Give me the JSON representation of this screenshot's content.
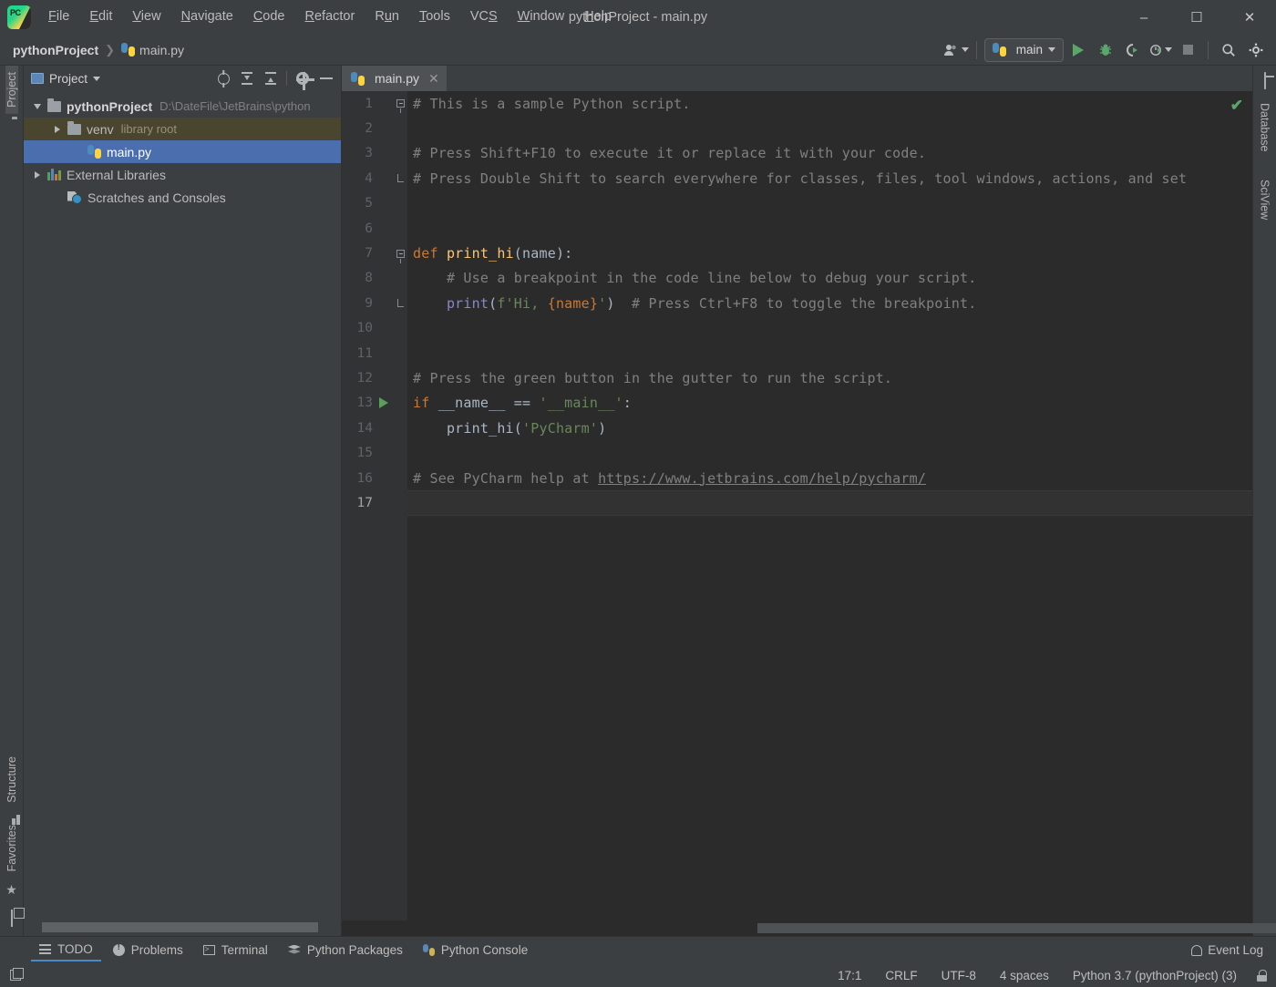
{
  "window": {
    "title": "pythonProject - main.py",
    "minimize_label": "–",
    "maximize_label": "☐",
    "close_label": "✕"
  },
  "menubar": {
    "items": [
      {
        "label": "File",
        "mnemonic": "F"
      },
      {
        "label": "Edit",
        "mnemonic": "E"
      },
      {
        "label": "View",
        "mnemonic": "V"
      },
      {
        "label": "Navigate",
        "mnemonic": "N"
      },
      {
        "label": "Code",
        "mnemonic": "C"
      },
      {
        "label": "Refactor",
        "mnemonic": "R"
      },
      {
        "label": "Run",
        "mnemonic": "u"
      },
      {
        "label": "Tools",
        "mnemonic": "T"
      },
      {
        "label": "VCS",
        "mnemonic": "S"
      },
      {
        "label": "Window",
        "mnemonic": "W"
      },
      {
        "label": "Help",
        "mnemonic": "H"
      }
    ]
  },
  "navbar": {
    "breadcrumb": [
      {
        "label": "pythonProject",
        "icon": "none"
      },
      {
        "label": "main.py",
        "icon": "python-file-icon"
      }
    ],
    "run_config": {
      "label": "main",
      "icon": "python-icon"
    },
    "buttons": [
      {
        "name": "user-account-button",
        "label": ""
      },
      {
        "name": "run-button",
        "label": ""
      },
      {
        "name": "debug-button",
        "label": ""
      },
      {
        "name": "run-coverage-button",
        "label": ""
      },
      {
        "name": "profile-button",
        "label": ""
      },
      {
        "name": "stop-button",
        "label": ""
      },
      {
        "name": "search-everywhere-button",
        "label": ""
      },
      {
        "name": "settings-button",
        "label": ""
      }
    ]
  },
  "left_stripe": {
    "top": [
      {
        "label": "Project",
        "selected": true
      }
    ],
    "bottom": [
      {
        "label": "Structure"
      },
      {
        "label": "Favorites"
      }
    ]
  },
  "right_stripe": {
    "items": [
      {
        "label": "Database"
      },
      {
        "label": "SciView"
      }
    ]
  },
  "project_panel": {
    "title": "Project",
    "tools": [
      "locate-icon",
      "expand-all-icon",
      "collapse-all-icon",
      "settings-icon",
      "hide-icon"
    ],
    "tree": [
      {
        "label": "pythonProject",
        "sub": "D:\\DateFile\\JetBrains\\python",
        "icon": "folder-icon",
        "arrow": "down",
        "indent": 0,
        "bold": true,
        "state": "normal"
      },
      {
        "label": "venv",
        "sub": "library root",
        "icon": "folder-icon",
        "arrow": "right",
        "indent": 1,
        "bold": false,
        "state": "excluded"
      },
      {
        "label": "main.py",
        "sub": "",
        "icon": "python-file-icon",
        "arrow": "none",
        "indent": 2,
        "bold": false,
        "state": "selected"
      },
      {
        "label": "External Libraries",
        "sub": "",
        "icon": "library-icon",
        "arrow": "right",
        "indent": 0,
        "bold": false,
        "state": "normal"
      },
      {
        "label": "Scratches and Consoles",
        "sub": "",
        "icon": "scratch-icon",
        "arrow": "none",
        "indent": 1,
        "bold": false,
        "state": "normal"
      }
    ]
  },
  "editor": {
    "tabs": [
      {
        "label": "main.py",
        "icon": "python-file-icon",
        "active": true,
        "close": "✕"
      }
    ],
    "inspection_status": "✔",
    "current_line": 17,
    "lines": [
      {
        "n": 1,
        "fold": "start",
        "runmark": false,
        "tokens": [
          {
            "t": "# This is a sample Python script.",
            "c": "cmt"
          }
        ]
      },
      {
        "n": 2,
        "fold": "none",
        "runmark": false,
        "tokens": []
      },
      {
        "n": 3,
        "fold": "none",
        "runmark": false,
        "tokens": [
          {
            "t": "# Press Shift+F10 to execute it or replace it with your code.",
            "c": "cmt"
          }
        ]
      },
      {
        "n": 4,
        "fold": "end",
        "runmark": false,
        "tokens": [
          {
            "t": "# Press Double Shift to search everywhere for classes, files, tool windows, actions, and set",
            "c": "cmt"
          }
        ]
      },
      {
        "n": 5,
        "fold": "none",
        "runmark": false,
        "tokens": []
      },
      {
        "n": 6,
        "fold": "none",
        "runmark": false,
        "tokens": []
      },
      {
        "n": 7,
        "fold": "start",
        "runmark": false,
        "tokens": [
          {
            "t": "def ",
            "c": "kw"
          },
          {
            "t": "print_hi",
            "c": "fn"
          },
          {
            "t": "(name):",
            "c": "pun"
          }
        ]
      },
      {
        "n": 8,
        "fold": "none",
        "runmark": false,
        "tokens": [
          {
            "t": "    ",
            "c": "pun"
          },
          {
            "t": "# Use a breakpoint in the code line below to debug your script.",
            "c": "cmt"
          }
        ]
      },
      {
        "n": 9,
        "fold": "end",
        "runmark": false,
        "tokens": [
          {
            "t": "    ",
            "c": "pun"
          },
          {
            "t": "print",
            "c": "bi"
          },
          {
            "t": "(",
            "c": "pun"
          },
          {
            "t": "f'Hi, ",
            "c": "str"
          },
          {
            "t": "{name}",
            "c": "kw"
          },
          {
            "t": "'",
            "c": "str"
          },
          {
            "t": ")  ",
            "c": "pun"
          },
          {
            "t": "# Press Ctrl+F8 to toggle the breakpoint.",
            "c": "cmt"
          }
        ]
      },
      {
        "n": 10,
        "fold": "none",
        "runmark": false,
        "tokens": []
      },
      {
        "n": 11,
        "fold": "none",
        "runmark": false,
        "tokens": []
      },
      {
        "n": 12,
        "fold": "none",
        "runmark": false,
        "tokens": [
          {
            "t": "# Press the green button in the gutter to run the script.",
            "c": "cmt"
          }
        ]
      },
      {
        "n": 13,
        "fold": "none",
        "runmark": true,
        "tokens": [
          {
            "t": "if ",
            "c": "kw"
          },
          {
            "t": "__name__ ",
            "c": "ident"
          },
          {
            "t": "== ",
            "c": "pun"
          },
          {
            "t": "'__main__'",
            "c": "str"
          },
          {
            "t": ":",
            "c": "pun"
          }
        ]
      },
      {
        "n": 14,
        "fold": "none",
        "runmark": false,
        "tokens": [
          {
            "t": "    ",
            "c": "pun"
          },
          {
            "t": "print_hi",
            "c": "ident"
          },
          {
            "t": "(",
            "c": "pun"
          },
          {
            "t": "'PyCharm'",
            "c": "str"
          },
          {
            "t": ")",
            "c": "pun"
          }
        ]
      },
      {
        "n": 15,
        "fold": "none",
        "runmark": false,
        "tokens": []
      },
      {
        "n": 16,
        "fold": "none",
        "runmark": false,
        "tokens": [
          {
            "t": "# See PyCharm help at ",
            "c": "cmt"
          },
          {
            "t": "https://www.jetbrains.com/help/pycharm/",
            "c": "link"
          }
        ]
      },
      {
        "n": 17,
        "fold": "none",
        "runmark": false,
        "tokens": []
      }
    ]
  },
  "bottom_tabs": [
    {
      "label": "TODO",
      "icon": "todo-icon",
      "selected": true
    },
    {
      "label": "Problems",
      "icon": "problems-icon",
      "selected": false
    },
    {
      "label": "Terminal",
      "icon": "terminal-icon",
      "selected": false
    },
    {
      "label": "Python Packages",
      "icon": "packages-icon",
      "selected": false
    },
    {
      "label": "Python Console",
      "icon": "python-console-icon",
      "selected": false
    }
  ],
  "event_log": {
    "label": "Event Log",
    "icon": "bell-icon"
  },
  "statusbar": {
    "caret": "17:1",
    "line_separator": "CRLF",
    "encoding": "UTF-8",
    "indent": "4 spaces",
    "interpreter": "Python 3.7 (pythonProject) (3)",
    "lock": "lock-icon"
  },
  "colors": {
    "accent_blue": "#4b6eaf",
    "run_green": "#59a869",
    "keyword_orange": "#cc7832",
    "string_green": "#6a8759",
    "function_yellow": "#ffc66d",
    "comment_gray": "#808080",
    "editor_bg": "#2b2b2b",
    "chrome_bg": "#3c3f41"
  }
}
